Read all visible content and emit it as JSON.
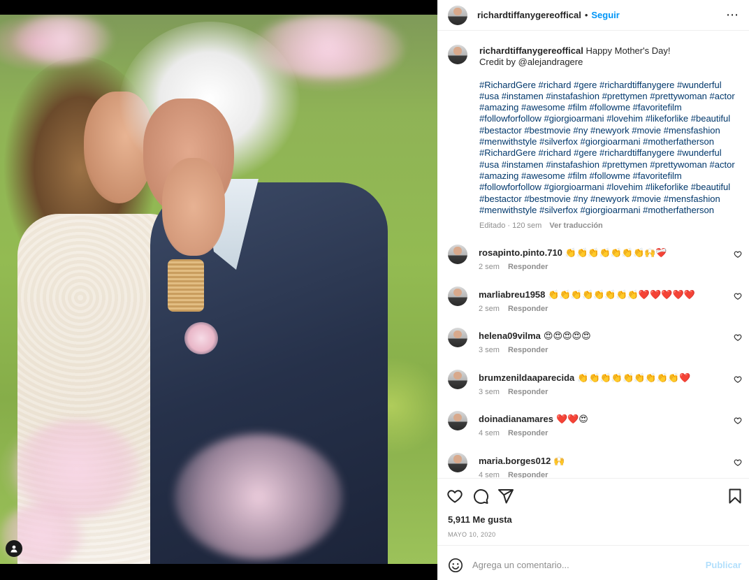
{
  "post": {
    "username": "richardtiffanygereoffical",
    "follow_label": "Seguir",
    "separator": "•",
    "more_icon": "⋯"
  },
  "caption": {
    "text": "Happy Mother's Day!",
    "credit": "Credit by @alejandragere",
    "hashtags": "#RichardGere #richard #gere #richardtiffanygere #wunderful #usa #instamen #instafashion #prettymen #prettywoman #actor #amazing #awesome #film #followme #favoritefilm #followforfollow #giorgioarmani #lovehim #likeforlike #beautiful #bestactor #bestmovie #ny #newyork #movie #mensfashion #menwithstyle #silverfox #giorgioarmani #motherfatherson #RichardGere #richard #gere #richardtiffanygere #wunderful #usa #instamen #instafashion #prettymen #prettywoman #actor #amazing #awesome #film #followme #favoritefilm #followforfollow #giorgioarmani #lovehim #likeforlike #beautiful #bestactor #bestmovie #ny #newyork #movie #mensfashion #menwithstyle #silverfox #giorgioarmani #motherfatherson",
    "edited": "Editado · 120 sem",
    "translate_label": "Ver traducción"
  },
  "comments": [
    {
      "username": "rosapinto.pinto.710",
      "text": "👏👏👏👏👏👏👏🙌❤️‍🩹",
      "time": "2 sem",
      "reply": "Responder"
    },
    {
      "username": "marliabreu1958",
      "text": "👏👏👏👏👏👏👏👏❤️❤️❤️❤️❤️",
      "time": "2 sem",
      "reply": "Responder"
    },
    {
      "username": "helena09vilma",
      "text": "😍😍😍😍😍",
      "time": "3 sem",
      "reply": "Responder"
    },
    {
      "username": "brumzenildaaparecida",
      "text": "👏👏👏👏👏👏👏👏👏❤️",
      "time": "3 sem",
      "reply": "Responder"
    },
    {
      "username": "doinadianamares",
      "text": "❤️❤️😍",
      "time": "4 sem",
      "reply": "Responder"
    },
    {
      "username": "maria.borges012",
      "text": "🙌",
      "time": "4 sem",
      "reply": "Responder"
    }
  ],
  "actions": {
    "likes": "5,911 Me gusta",
    "date": "MAYO 10, 2020",
    "icons": [
      "heart-outline",
      "comment-bubble",
      "paper-plane",
      "bookmark-outline"
    ]
  },
  "add_comment": {
    "placeholder": "Agrega un comentario...",
    "publish_label": "Publicar"
  },
  "colors": {
    "link_blue": "#0095f6",
    "hashtag_blue": "#00376b",
    "muted_gray": "#8e8e8e",
    "publish_disabled": "#b2dffc"
  }
}
